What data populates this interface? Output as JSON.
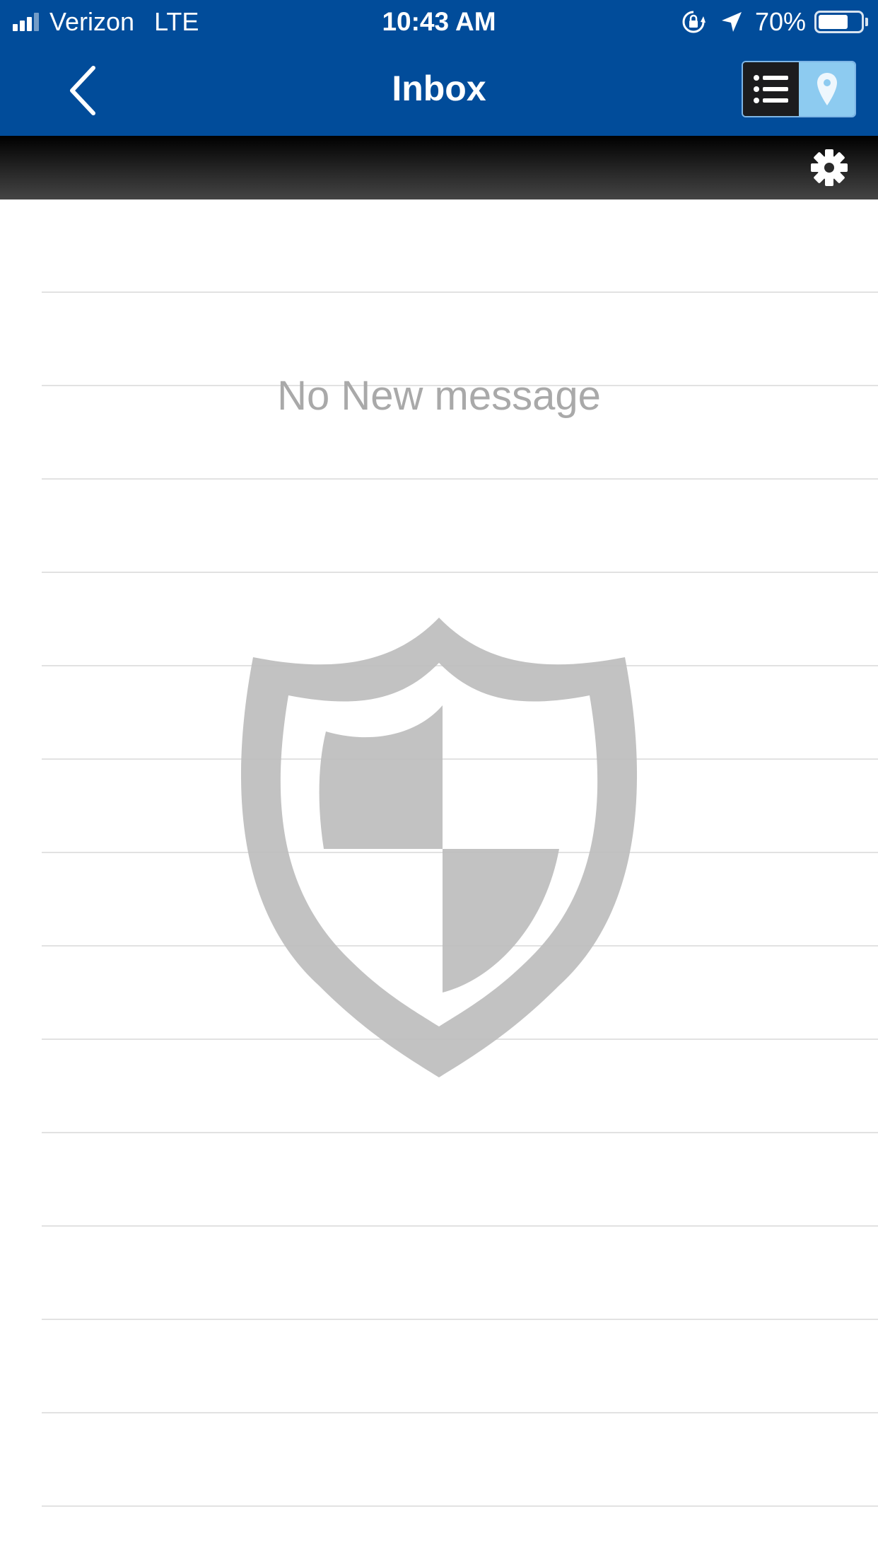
{
  "status_bar": {
    "carrier": "Verizon",
    "network": "LTE",
    "time": "10:43 AM",
    "battery_percent": "70%",
    "battery_level": 0.7,
    "signal_bars_filled": 3,
    "signal_bars_total": 4
  },
  "nav": {
    "back_icon": "chevron-left-icon",
    "title": "Inbox",
    "view_toggle": {
      "options": [
        "list",
        "map"
      ],
      "selected": "list"
    }
  },
  "toolbar": {
    "settings_icon": "gear-icon"
  },
  "inbox": {
    "empty_message": "No New message",
    "placeholder_icon": "shield-icon",
    "row_count": 14
  },
  "colors": {
    "header_blue": "#014c9a",
    "toggle_active": "#1c1c1e",
    "toggle_inactive": "#8dcbf0",
    "placeholder_gray": "#c4c4c4",
    "message_gray": "#a9a9a9"
  }
}
